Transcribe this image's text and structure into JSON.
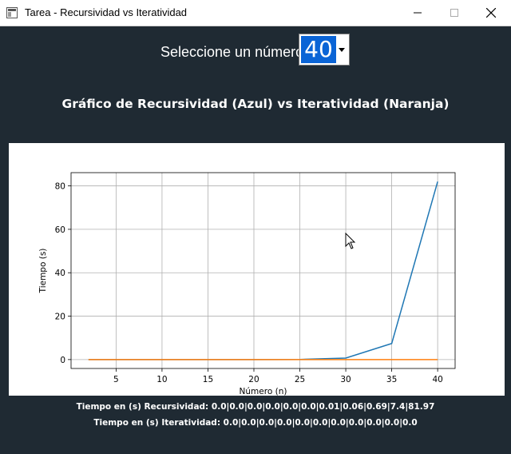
{
  "window": {
    "title": "Tarea - Recursividad vs Iteratividad"
  },
  "selector": {
    "label": "Seleccione un número",
    "value": "40"
  },
  "chart_title": "Gráfico de Recursividad (Azul) vs Iteratividad (Naranja)",
  "chart_data": {
    "type": "line",
    "xlabel": "Número (n)",
    "ylabel": "Tiempo (s)",
    "xlim": [
      0.1,
      41.9
    ],
    "ylim": [
      -4.1,
      86.1
    ],
    "x_ticks": [
      5,
      10,
      15,
      20,
      25,
      30,
      35,
      40
    ],
    "y_ticks": [
      0,
      20,
      40,
      60,
      80
    ],
    "grid": true,
    "series": [
      {
        "color": "#1f77b4",
        "x": [
          2,
          5,
          10,
          15,
          20,
          25,
          30,
          35,
          40
        ],
        "values": [
          0.0,
          0.0,
          0.0,
          0.0,
          0.0,
          0.06,
          0.69,
          7.4,
          81.97
        ]
      },
      {
        "color": "#ff7f0e",
        "x": [
          2,
          5,
          10,
          15,
          20,
          25,
          30,
          35,
          40
        ],
        "values": [
          0.0,
          0.0,
          0.0,
          0.0,
          0.0,
          0.0,
          0.0,
          0.0,
          0.0
        ]
      }
    ]
  },
  "times": {
    "recursividad": "Tiempo en (s) Recursividad: 0.0|0.0|0.0|0.0|0.0|0.0|0.01|0.06|0.69|7.4|81.97",
    "iteratividad": "Tiempo en (s) Iteratividad: 0.0|0.0|0.0|0.0|0.0|0.0|0.0|0.0|0.0|0.0|0.0"
  },
  "icons": {
    "app": "app-icon",
    "minimize": "minimize-icon",
    "maximize": "maximize-icon",
    "close": "close-icon",
    "dropdown": "dropdown-arrow-icon",
    "cursor": "mouse-cursor-icon"
  }
}
